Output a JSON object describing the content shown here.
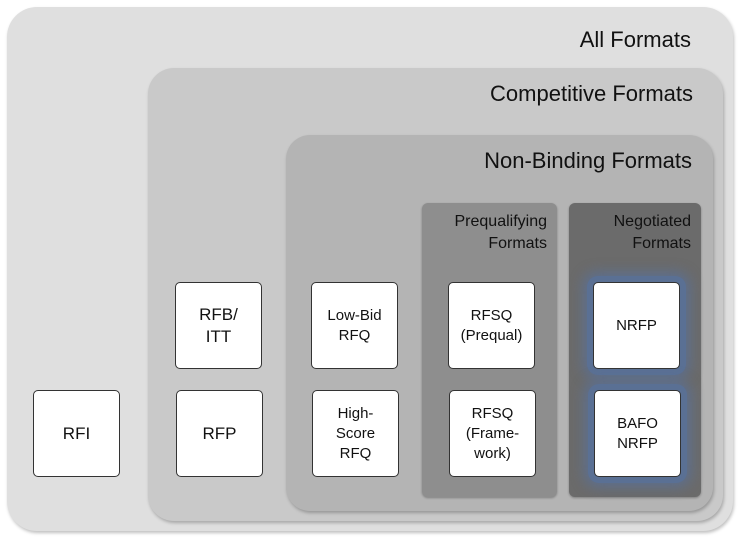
{
  "diagram": {
    "containers": {
      "all": {
        "label": "All Formats"
      },
      "competitive": {
        "label": "Competitive Formats"
      },
      "non_binding": {
        "label": "Non-Binding Formats"
      },
      "prequalifying": {
        "label": "Prequalifying Formats"
      },
      "negotiated": {
        "label": "Negotiated Formats"
      }
    },
    "boxes": {
      "rfi": "RFI",
      "rfb_itt": "RFB/ ITT",
      "rfp": "RFP",
      "low_bid_rfq": "Low-Bid RFQ",
      "high_score_rfq": "High- Score RFQ",
      "rfsq_prequal": "RFSQ (Prequal)",
      "rfsq_framework": "RFSQ (Frame- work)",
      "nrfp": "NRFP",
      "bafo_nrfp": "BAFO NRFP"
    },
    "colors": {
      "all": "#dfdfdf",
      "competitive": "#c9c9c9",
      "non_binding": "#b4b4b4",
      "prequalifying": "#8e8e8e",
      "negotiated": "#6b6b6b",
      "highlight_glow": "#5a7094"
    }
  }
}
